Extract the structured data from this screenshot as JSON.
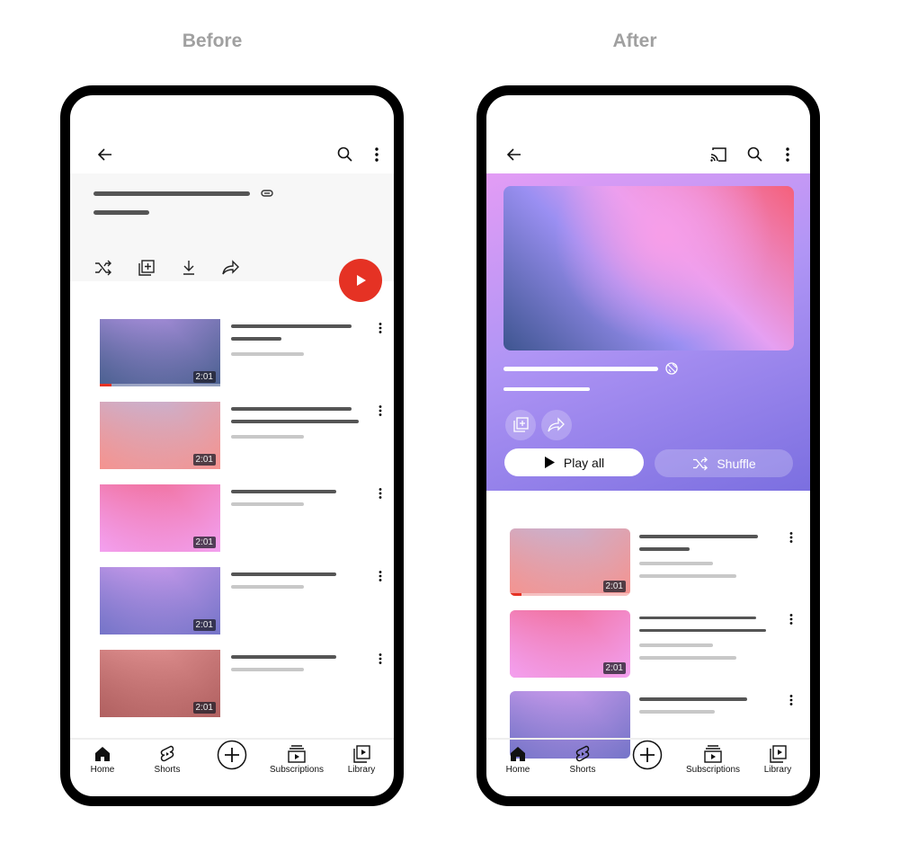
{
  "captions": {
    "before": "Before",
    "after": "After"
  },
  "colors": {
    "fab": "#e53224",
    "before_header": "#f7f7f7",
    "after_header_start": "#e39cf5",
    "after_header_end": "#7b6fe0"
  },
  "before": {
    "icons": [
      "back-arrow-icon",
      "search-icon",
      "more-vert-icon",
      "link-icon",
      "shuffle-icon",
      "add-to-playlist-icon",
      "download-icon",
      "share-icon",
      "play-icon"
    ],
    "videos": [
      {
        "duration": "2:01",
        "progress": 0.1,
        "gradient": [
          "#4a6090",
          "#c99ef5"
        ]
      },
      {
        "duration": "2:01",
        "gradient": [
          "#f5938f",
          "#b8bde8"
        ]
      },
      {
        "duration": "2:01",
        "gradient": [
          "#f3a0f0",
          "#f06080"
        ]
      },
      {
        "duration": "2:01",
        "gradient": [
          "#7474c8",
          "#e8a8f8"
        ]
      },
      {
        "duration": "2:01",
        "gradient": [
          "#b06060",
          "#f0a0a0"
        ]
      }
    ]
  },
  "after": {
    "icons": [
      "back-arrow-icon",
      "cast-icon",
      "search-icon",
      "more-vert-icon",
      "globe-icon",
      "add-to-playlist-icon",
      "share-icon"
    ],
    "play_all": "Play all",
    "shuffle": "Shuffle",
    "videos": [
      {
        "duration": "2:01",
        "progress": 0.1,
        "gradient": [
          "#f5938f",
          "#b8bde8"
        ]
      },
      {
        "duration": "2:01",
        "gradient": [
          "#f3a0f0",
          "#f06080"
        ]
      },
      {
        "duration": "",
        "gradient": [
          "#7474c8",
          "#e8a8f8"
        ]
      }
    ]
  },
  "nav": [
    {
      "label": "Home"
    },
    {
      "label": "Shorts"
    },
    {
      "label": ""
    },
    {
      "label": "Subscriptions"
    },
    {
      "label": "Library"
    }
  ]
}
